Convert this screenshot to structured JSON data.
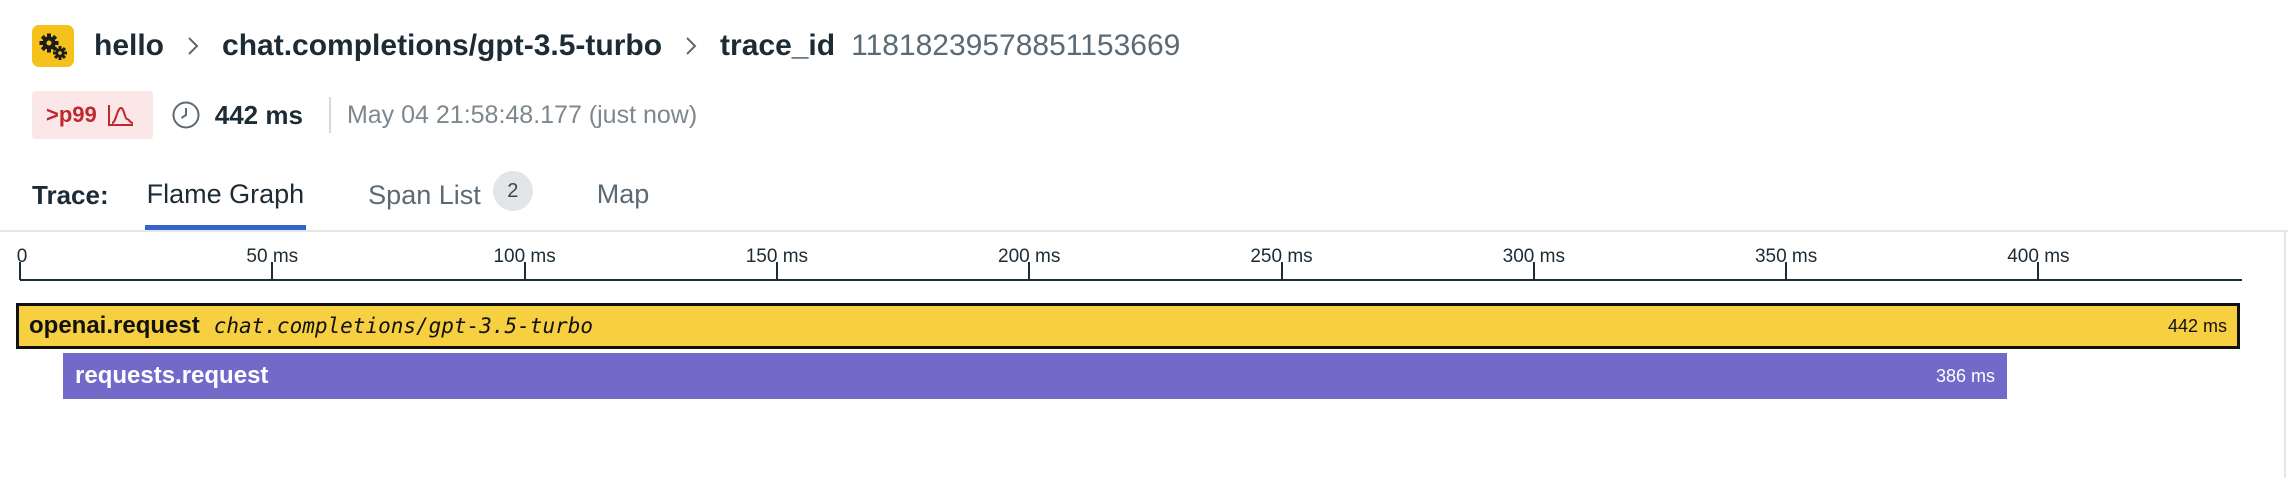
{
  "breadcrumb": {
    "service_icon": "gears-icon",
    "service_color": "#f5c21b",
    "service": "hello",
    "resource": "chat.completions/gpt-3.5-turbo",
    "trace_label": "trace_id",
    "trace_id": "11818239578851153669"
  },
  "meta": {
    "percentile_badge": ">p99",
    "percentile_color": "#c1272d",
    "duration": "442 ms",
    "timestamp": "May 04 21:58:48.177 (just now)"
  },
  "tabs": {
    "label": "Trace:",
    "items": [
      {
        "label": "Flame Graph",
        "active": true
      },
      {
        "label": "Span List",
        "count": "2",
        "active": false
      },
      {
        "label": "Map",
        "active": false
      }
    ]
  },
  "axis": {
    "ticks": [
      "0",
      "50 ms",
      "100 ms",
      "150 ms",
      "200 ms",
      "250 ms",
      "300 ms",
      "350 ms",
      "400 ms"
    ]
  },
  "spans": [
    {
      "name": "openai.request",
      "resource": "chat.completions/gpt-3.5-turbo",
      "duration": "442 ms",
      "color": "#f6d040",
      "selected": true
    },
    {
      "name": "requests.request",
      "duration": "386 ms",
      "color": "#726ac9",
      "selected": false
    }
  ]
}
